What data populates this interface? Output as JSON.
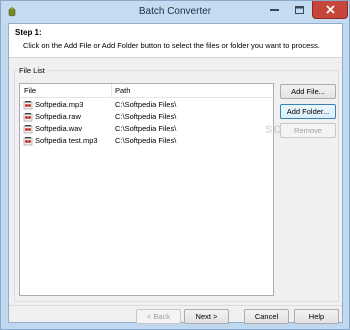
{
  "window": {
    "title": "Batch Converter"
  },
  "header": {
    "step_title": "Step 1:",
    "step_description": "Click on the Add File or Add Folder button to select the files or folder you want to process."
  },
  "file_list": {
    "group_label": "File List",
    "columns": [
      "File",
      "Path"
    ],
    "rows": [
      {
        "file": "Softpedia.mp3",
        "path": "C:\\Softpedia Files\\",
        "icon": "audio-file-icon"
      },
      {
        "file": "Softpedia.raw",
        "path": "C:\\Softpedia Files\\",
        "icon": "audio-file-icon"
      },
      {
        "file": "Softpedia.wav",
        "path": "C:\\Softpedia Files\\",
        "icon": "audio-file-icon"
      },
      {
        "file": "Softpedia test.mp3",
        "path": "C:\\Softpedia Files\\",
        "icon": "audio-file-icon"
      }
    ]
  },
  "side_buttons": {
    "add_file": "Add File...",
    "add_folder": "Add Folder...",
    "remove": "Remove"
  },
  "nav_buttons": {
    "back": "< Back",
    "next": "Next >",
    "cancel": "Cancel",
    "help": "Help"
  },
  "watermark": "SOFTPEDIA",
  "colors": {
    "frame": "#bfd7ef",
    "close_button": "#c7463c",
    "client_bg": "#f0f0f0"
  }
}
